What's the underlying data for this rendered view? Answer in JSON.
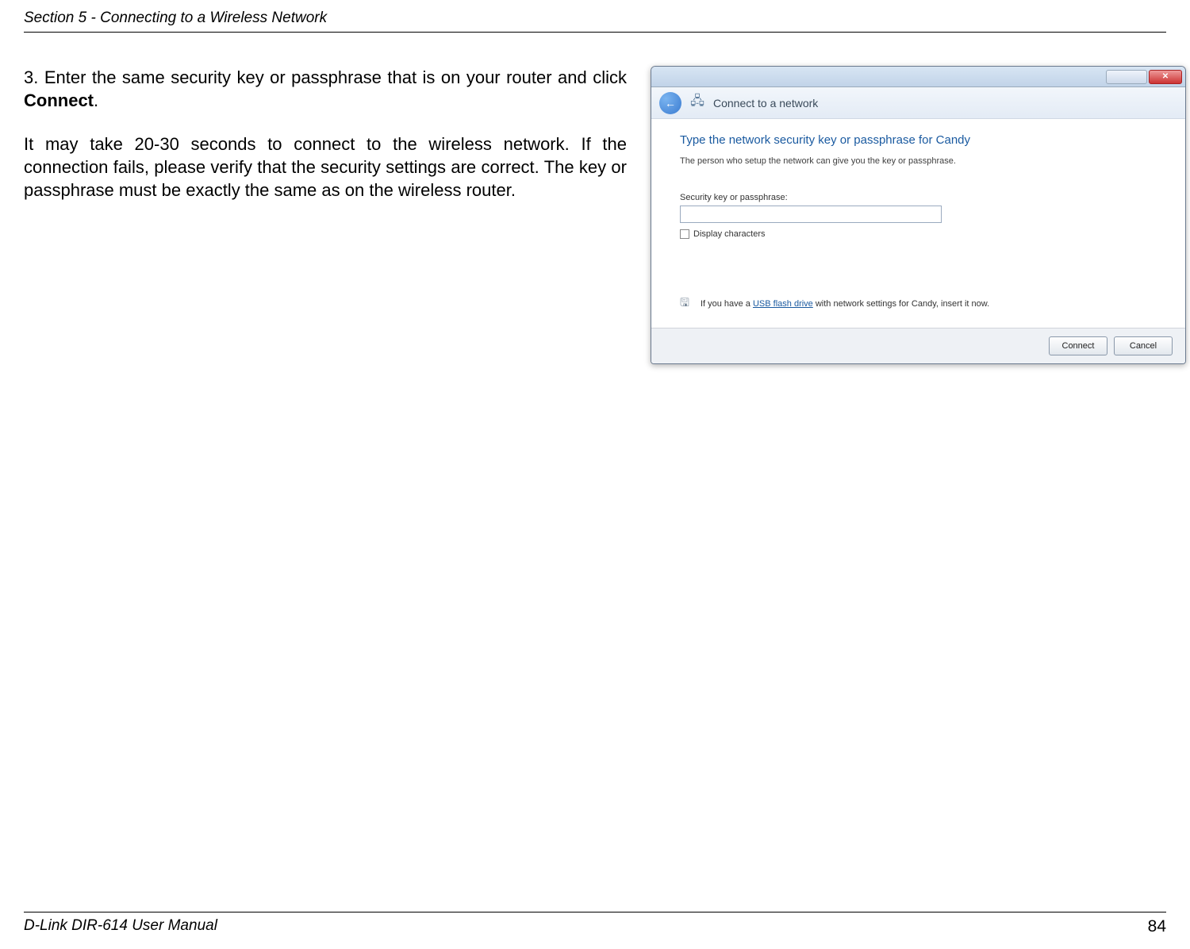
{
  "header": {
    "section_title": "Section 5 - Connecting to a Wireless Network"
  },
  "body": {
    "step_number": "3.",
    "step_text_before_bold": "Enter the same security key or passphrase that is on your router and click ",
    "step_bold": "Connect",
    "step_after_bold": ".",
    "paragraph": "It may take 20-30 seconds to connect to the wireless network. If the connection fails, please verify that the security settings are correct. The key or passphrase must be exactly the same as on the wireless router."
  },
  "dialog": {
    "nav_text": "Connect to a network",
    "title": "Type the network security key or passphrase for Candy",
    "subtitle": "The person who setup the network can give you the key or passphrase.",
    "input_label": "Security key or passphrase:",
    "input_value": "",
    "checkbox_label": "Display characters",
    "usb_before": "If you have a ",
    "usb_link": "USB flash drive",
    "usb_after": " with network settings for Candy, insert it now.",
    "btn_connect": "Connect",
    "btn_cancel": "Cancel"
  },
  "footer": {
    "manual": "D-Link DIR-614 User Manual",
    "page": "84"
  }
}
